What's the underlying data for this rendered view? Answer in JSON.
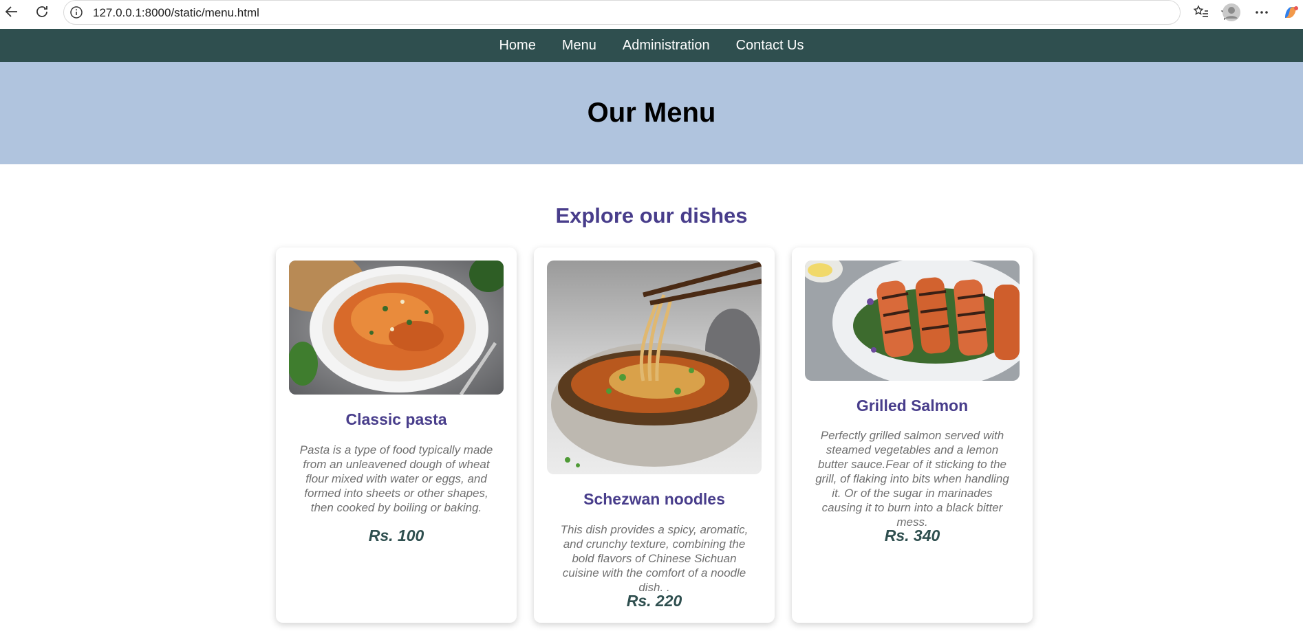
{
  "browser": {
    "url": "127.0.0.1:8000/static/menu.html"
  },
  "nav": {
    "items": [
      {
        "label": "Home"
      },
      {
        "label": "Menu"
      },
      {
        "label": "Administration"
      },
      {
        "label": "Contact Us"
      }
    ],
    "background": "#2f4f4f"
  },
  "hero": {
    "title": "Our Menu",
    "background": "#b0c4de"
  },
  "section": {
    "title": "Explore our dishes",
    "accent": "#483d8b"
  },
  "dishes": [
    {
      "name": "Classic pasta",
      "description": "Pasta is a type of food typically made from an unleavened dough of wheat flour mixed with water or eggs, and formed into sheets or other shapes, then cooked by boiling or baking.",
      "price": "Rs. 100",
      "image_icon": "pasta-photo"
    },
    {
      "name": "Schezwan noodles",
      "description": "This dish provides a spicy, aromatic, and crunchy texture, combining the bold flavors of Chinese Sichuan cuisine with the comfort of a noodle dish. .",
      "price": "Rs. 220",
      "image_icon": "noodles-photo"
    },
    {
      "name": "Grilled Salmon",
      "description": "Perfectly grilled salmon served with steamed vegetables and a lemon butter sauce.Fear of it sticking to the grill, of flaking into bits when handling it. Or of the sugar in marinades causing it to burn into a black bitter mess.",
      "price": "Rs. 340",
      "image_icon": "salmon-photo"
    }
  ]
}
